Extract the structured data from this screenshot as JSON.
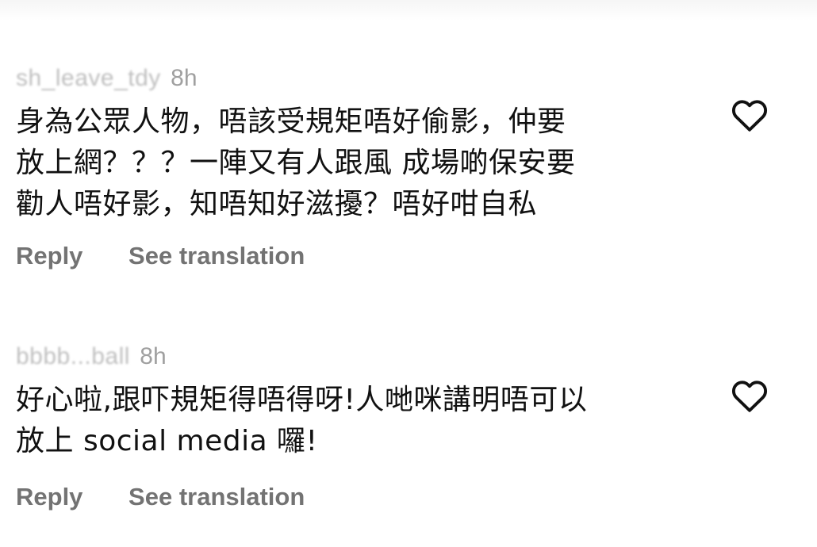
{
  "comments": [
    {
      "username": "sh​_​leave_tdy",
      "time": "8h",
      "lines": [
        "身為公眾人物，唔該受規矩唔好偷影，仲要",
        "放上網？？？一陣又有人跟風 成場啲保安要",
        "勸人唔好影，知唔知好滋擾？唔好咁自私"
      ],
      "reply_label": "Reply",
      "translate_label": "See translation",
      "like_icon": "heart-outline-icon"
    },
    {
      "username": "bbbb...ball",
      "time": "8h",
      "lines": [
        "好心啦,跟吓規矩得唔得呀!人哋咪講明唔可以",
        "放上 social media 囉!"
      ],
      "reply_label": "Reply",
      "translate_label": "See translation",
      "like_icon": "heart-outline-icon"
    }
  ],
  "colors": {
    "text": "#111111",
    "secondary": "#737373",
    "username": "#bfbfbf",
    "heart_stroke": "#111111"
  }
}
